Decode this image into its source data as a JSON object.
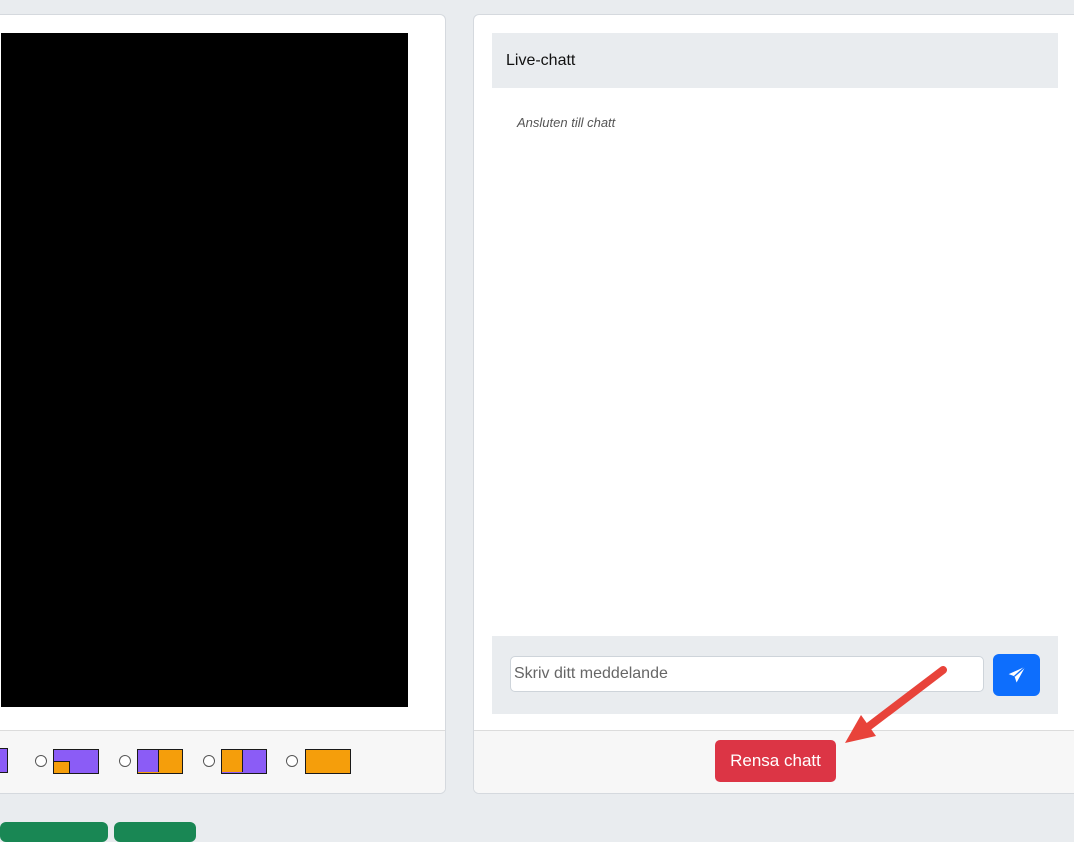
{
  "chat": {
    "title": "Live-chatt",
    "status_message": "Ansluten till chatt",
    "input_placeholder": "Skriv ditt meddelande",
    "clear_label": "Rensa chatt",
    "send_icon": "paper-plane-icon"
  },
  "layouts": [
    {
      "name": "layout-partial"
    },
    {
      "name": "layout-purple-with-orange-inset"
    },
    {
      "name": "layout-purple-orange-split"
    },
    {
      "name": "layout-orange-purple-split"
    },
    {
      "name": "layout-orange-full"
    }
  ],
  "colors": {
    "purple": "#8b5cf6",
    "orange": "#f59e0b",
    "send_blue": "#0d6efd",
    "clear_red": "#dc3545",
    "annotation_red": "#e8433a"
  }
}
